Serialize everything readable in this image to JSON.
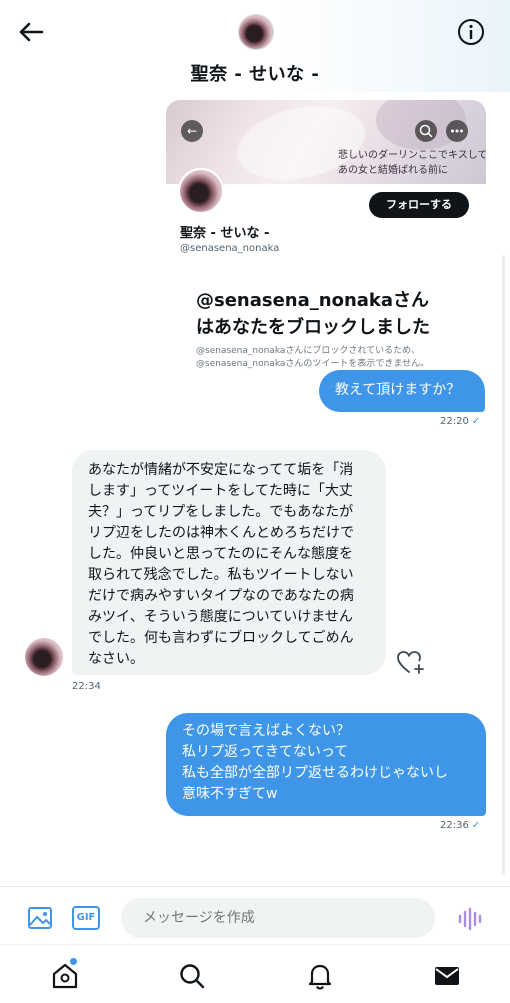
{
  "header": {
    "title": "聖奈 - せいな -",
    "back_icon": "arrow-left-icon",
    "info_icon": "info-icon"
  },
  "profile_card": {
    "banner_text_line1": "悲しいのダーリンここでキスして",
    "banner_text_line2": "あの女と結婚ばれる前に",
    "name": "聖奈 - せいな -",
    "handle": "@senasena_nonaka",
    "follow_label": "フォローする"
  },
  "block_notice": {
    "title_line1": "@senasena_nonakaさん",
    "title_line2": "はあなたをブロックしました",
    "desc_line1": "@senasena_nonakaさんにブロックされているため、",
    "desc_line2": "@senasena_nonakaさんのツイートを表示できません。"
  },
  "messages": [
    {
      "direction": "out",
      "lines": [
        "教えて頂けますか？"
      ],
      "time": "22:20"
    },
    {
      "direction": "in",
      "lines": [
        "あなたが情緒が不安定になってて垢を「消",
        "します」ってツイートをしてた時に「大丈",
        "夫？」ってリプをしました。でもあなたが",
        "リプ辺をしたのは神木くんとめろちだけで",
        "した。仲良いと思ってたのにそんな態度を",
        "取られて残念でした。私もツイートしない",
        "だけで病みやすいタイプなのであなたの病",
        "みツイ、そういう態度についていけません",
        "でした。何も言わずにブロックしてごめん",
        "なさい。"
      ],
      "time": "22:34"
    },
    {
      "direction": "out",
      "lines": [
        "その場で言えばよくない？",
        "私リプ返ってきてないって",
        "私も全部が全部リプ返せるわけじゃないし",
        "意味不すぎてw"
      ],
      "time": "22:36"
    }
  ],
  "read_mark": "✓",
  "composer": {
    "placeholder": "メッセージを作成",
    "gif_label": "GIF"
  },
  "tabs": [
    "home-icon",
    "search-icon",
    "bell-icon",
    "envelope-icon"
  ],
  "colors": {
    "accent": "#3f96e9",
    "bubble_in": "#eff3f4",
    "text": "#0f1419"
  }
}
